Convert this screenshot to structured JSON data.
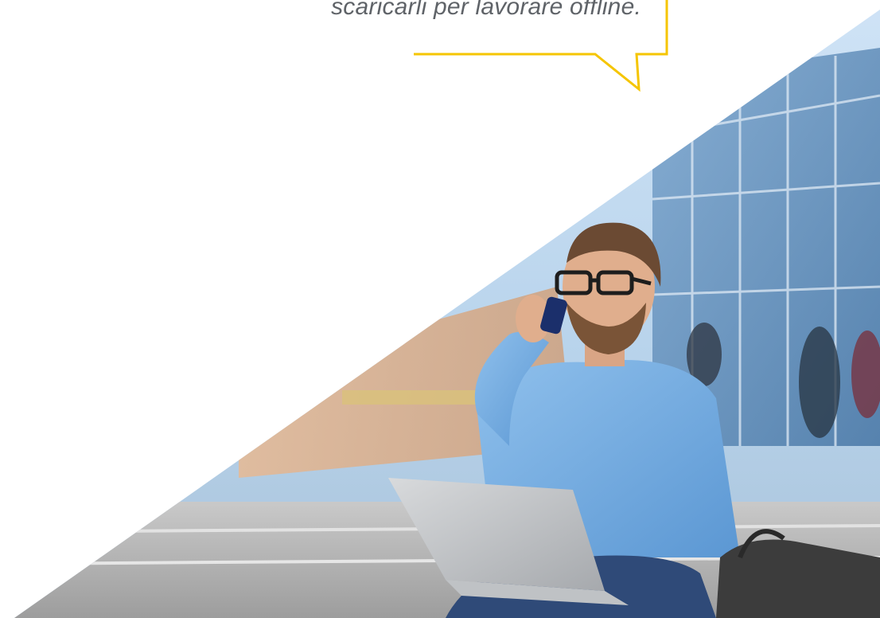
{
  "banner": {
    "quote_text": "scaricarli per lavorare offline.",
    "photo": "man-with-phone-and-laptop-photo",
    "bubble_icon": "speech-bubble-outline",
    "accent_color": "#f5c500"
  }
}
